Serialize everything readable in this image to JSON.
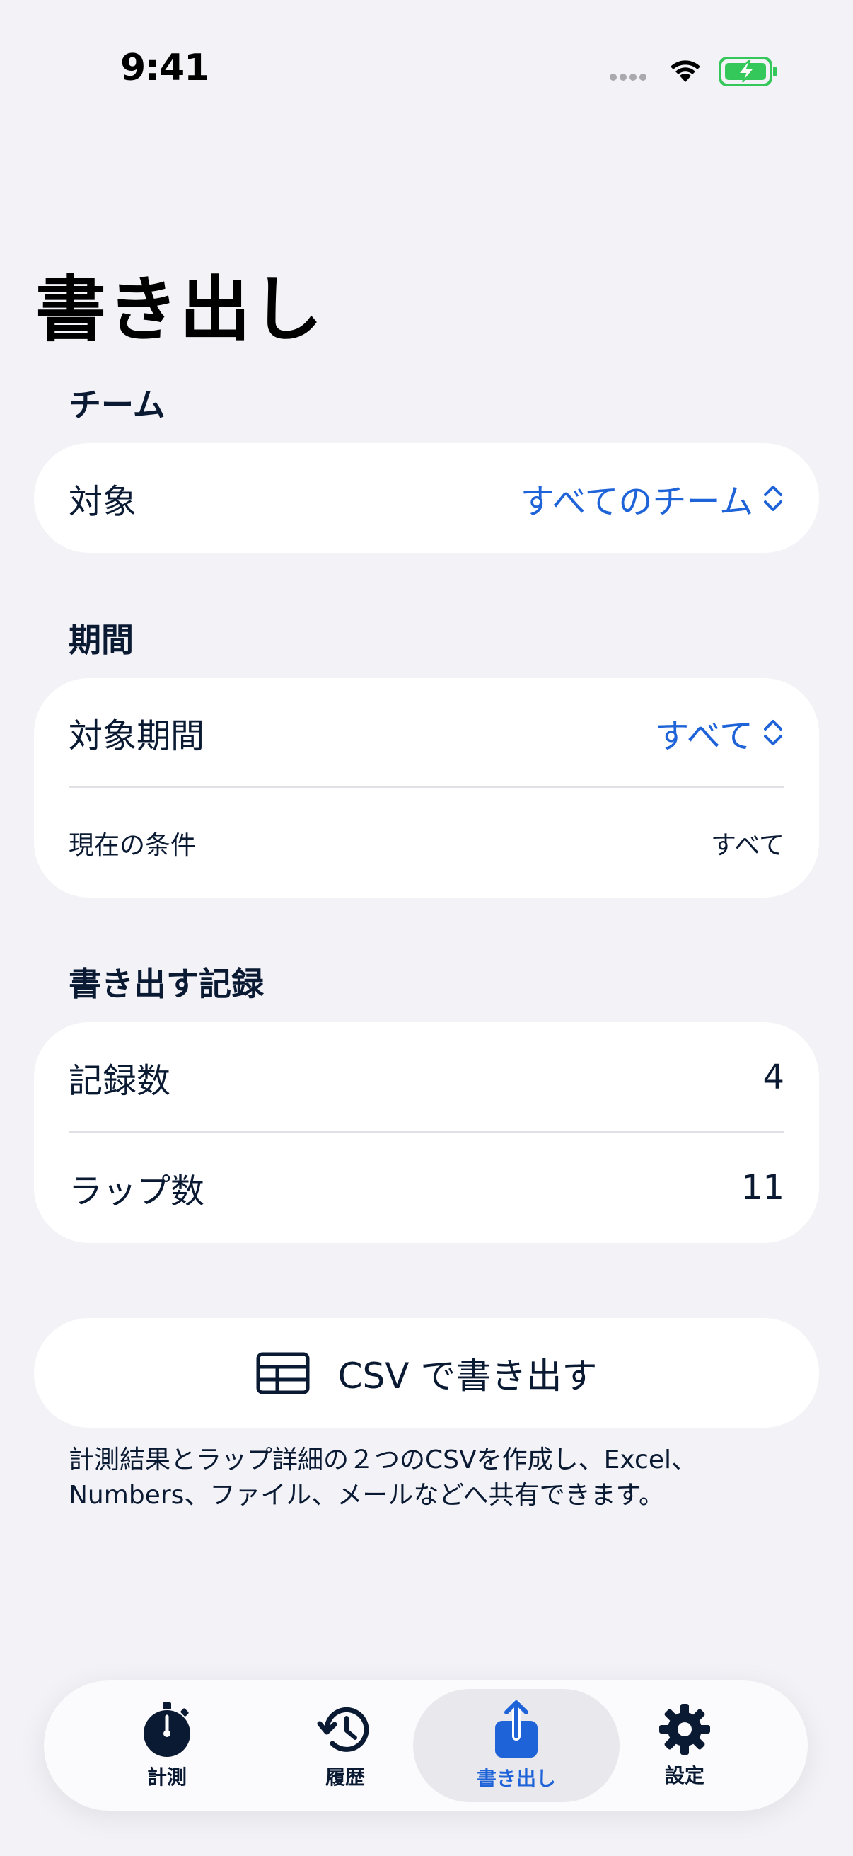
{
  "status_bar": {
    "time": "9:41"
  },
  "page": {
    "title": "書き出し"
  },
  "team_section": {
    "header": "チーム",
    "target_label": "対象",
    "target_value": "すべてのチーム"
  },
  "period_section": {
    "header": "期間",
    "period_label": "対象期間",
    "period_value": "すべて",
    "current_condition_label": "現在の条件",
    "current_condition_value": "すべて"
  },
  "records_section": {
    "header": "書き出す記録",
    "record_count_label": "記録数",
    "record_count_value": "4",
    "lap_count_label": "ラップ数",
    "lap_count_value": "11"
  },
  "export": {
    "button_label": "CSV で書き出す",
    "button_icon": "table-icon",
    "footnote": "計測結果とラップ詳細の２つのCSVを作成し、Excel、Numbers、ファイル、メールなどへ共有できます。"
  },
  "tab_bar": {
    "tabs": [
      {
        "label": "計測",
        "icon": "stopwatch-icon"
      },
      {
        "label": "履歴",
        "icon": "history-icon"
      },
      {
        "label": "書き出し",
        "icon": "share-icon",
        "selected": true
      },
      {
        "label": "設定",
        "icon": "gear-icon"
      }
    ]
  },
  "colors": {
    "accent": "#1f63d8",
    "text": "#0b1a33",
    "background": "#f2f2f7",
    "card": "#ffffff",
    "battery": "#34c759"
  }
}
